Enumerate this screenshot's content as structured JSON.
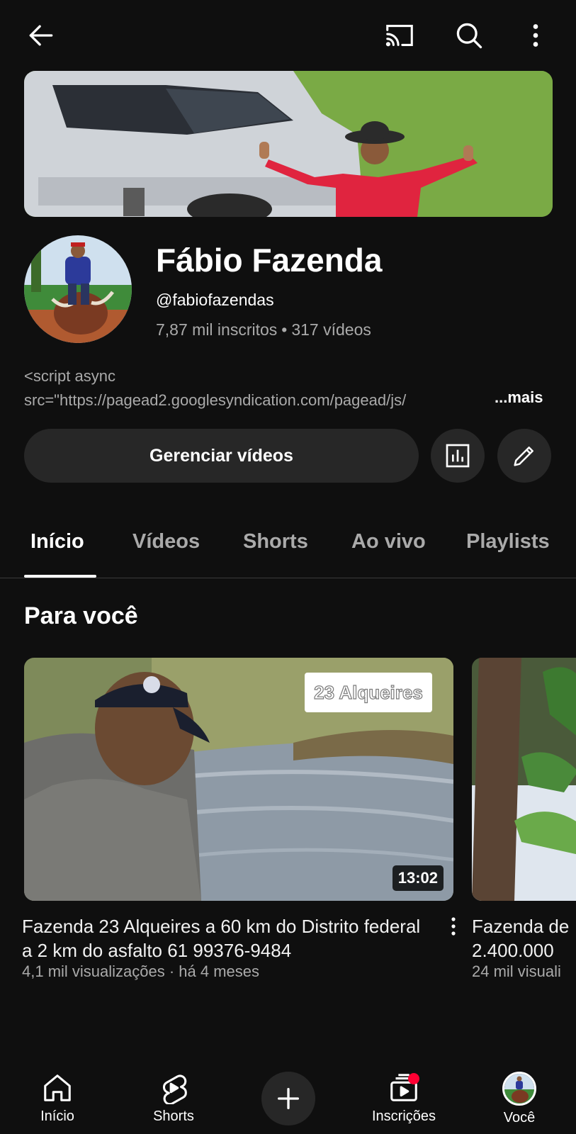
{
  "topbar": {
    "back_icon": "arrow-left-icon",
    "cast_icon": "cast-icon",
    "search_icon": "search-icon",
    "more_icon": "more-vertical-icon"
  },
  "channel": {
    "name": "Fábio Fazenda",
    "handle": "@fabiofazendas",
    "subscribers": "7,87 mil inscritos",
    "separator": "•",
    "videos_count": "317 vídeos",
    "description_line1": "<script async",
    "description_line2": "src=\"https://pagead2.googlesyndication.com/pagead/js/",
    "more_label": "...mais"
  },
  "actions": {
    "manage_label": "Gerenciar vídeos",
    "analytics_icon": "analytics-icon",
    "edit_icon": "pencil-icon"
  },
  "tabs": [
    {
      "label": "Início",
      "active": true
    },
    {
      "label": "Vídeos",
      "active": false
    },
    {
      "label": "Shorts",
      "active": false
    },
    {
      "label": "Ao vivo",
      "active": false
    },
    {
      "label": "Playlists",
      "active": false
    }
  ],
  "section": {
    "title": "Para você"
  },
  "videos": [
    {
      "overlay_text": "23 Alqueires",
      "duration": "13:02",
      "title": "Fazenda 23 Alqueires a 60 km do Distrito federal a 2 km do asfalto 61 99376-9484",
      "meta": "4,1 mil visualizações · há 4 meses"
    },
    {
      "title_line1": "Fazenda de",
      "title_line2": "2.400.000",
      "meta": "24 mil visuali"
    }
  ],
  "bottom_nav": [
    {
      "label": "Início",
      "icon": "home-icon"
    },
    {
      "label": "Shorts",
      "icon": "shorts-icon"
    },
    {
      "label": "",
      "icon": "plus-icon"
    },
    {
      "label": "Inscrições",
      "icon": "subscriptions-icon"
    },
    {
      "label": "Você",
      "icon": "avatar"
    }
  ],
  "colors": {
    "background": "#0f0f0f",
    "surface": "#272727",
    "text_primary": "#f1f1f1",
    "text_secondary": "#aaaaaa",
    "notification": "#ff0033"
  }
}
